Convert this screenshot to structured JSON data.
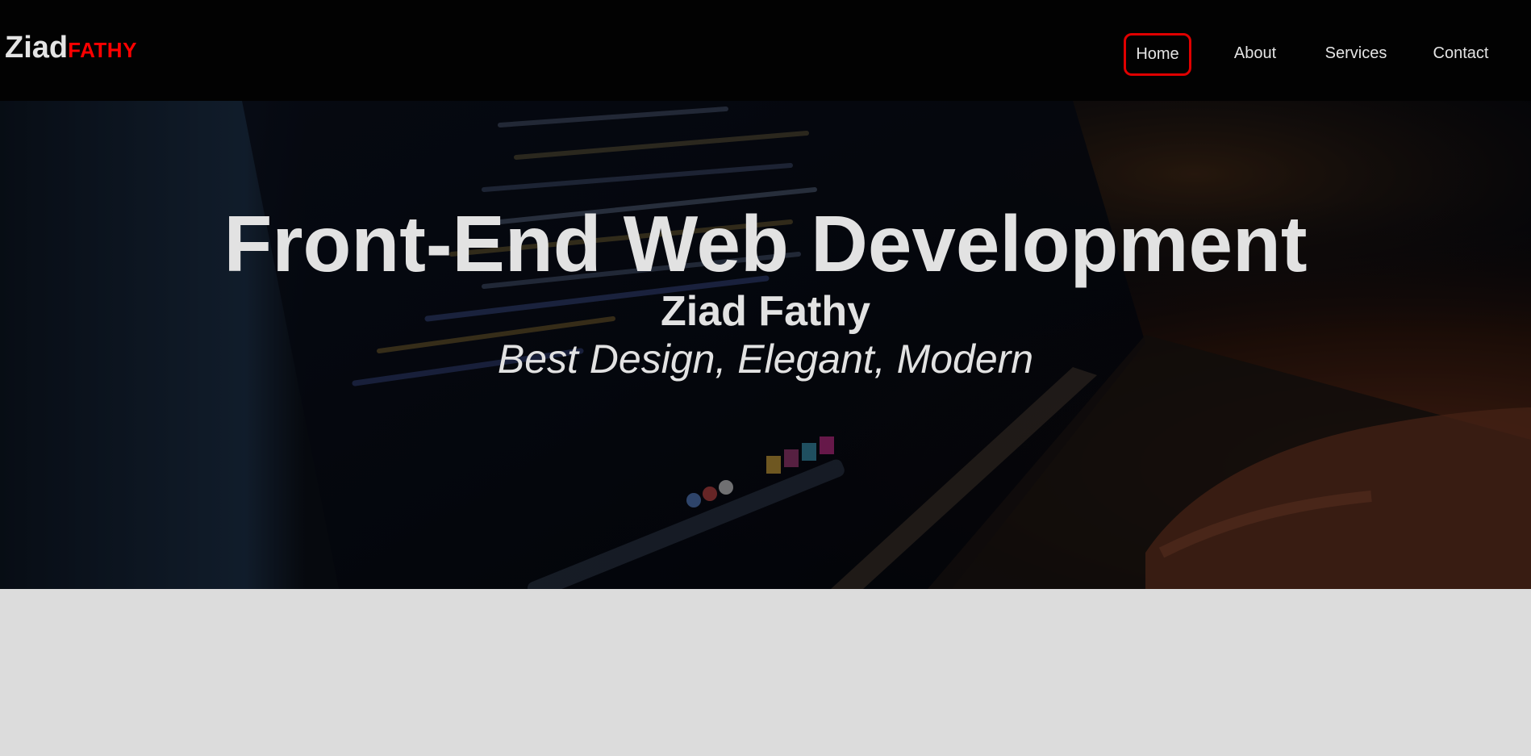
{
  "brand": {
    "first": "Ziad",
    "last": "FATHY",
    "accent_color": "#ff0000"
  },
  "nav": {
    "items": [
      {
        "label": "Home",
        "active": true
      },
      {
        "label": "About",
        "active": false
      },
      {
        "label": "Services",
        "active": false
      },
      {
        "label": "Contact",
        "active": false
      }
    ]
  },
  "hero": {
    "title": "Front-End Web Development",
    "name": "Ziad Fathy",
    "tagline": "Best Design, Elegant, Modern",
    "background": "photo of a laptop screen showing code with a hand on the keyboard, darkened overlay"
  }
}
